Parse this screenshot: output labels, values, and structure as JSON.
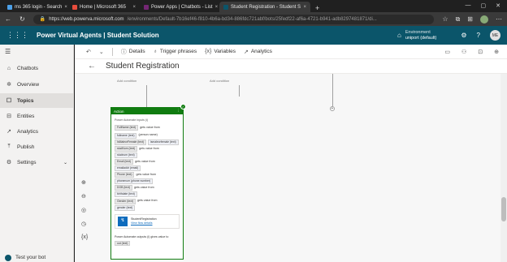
{
  "browser": {
    "tabs": [
      {
        "label": "ms 365 login - Search",
        "color": "#4ca0e8",
        "active": false
      },
      {
        "label": "Home | Microsoft 365",
        "color": "#e74c3c",
        "active": false
      },
      {
        "label": "Power Apps | Chatbots - List",
        "color": "#742774",
        "active": false
      },
      {
        "label": "Student Registration - Student S",
        "color": "#0b556a",
        "active": true
      }
    ],
    "new_tab": "+",
    "url_host": "https://web.powerva.microsoft.com",
    "url_path": "/environments/Default-7b16ef46-f810-4b6a-bd34-886fdc721abf/bots/25fedf22-af6a-4721-b941-adb8297481871/di..."
  },
  "app": {
    "title": "Power Virtual Agents | Student Solution",
    "env_label": "Environment",
    "env_name": "uniport (default)",
    "user_initials": "ME"
  },
  "sidebar": {
    "items": [
      {
        "label": "Chatbots",
        "icon": "home-icon"
      },
      {
        "label": "Overview",
        "icon": "gear-icon"
      },
      {
        "label": "Topics",
        "icon": "topics-icon"
      },
      {
        "label": "Entities",
        "icon": "entities-icon"
      },
      {
        "label": "Analytics",
        "icon": "analytics-icon"
      },
      {
        "label": "Publish",
        "icon": "publish-icon"
      },
      {
        "label": "Settings",
        "icon": "settings-icon"
      }
    ],
    "test_bot": "Test your bot"
  },
  "commandbar": {
    "details": "Details",
    "trigger": "Trigger phrases",
    "variables": "Variables",
    "analytics": "Analytics"
  },
  "page": {
    "title": "Student Registration",
    "add_condition_1": "Add condition",
    "add_condition_2": "Add condition"
  },
  "action_card": {
    "header": "Action",
    "inputs_heading": "Power Automate inputs (i)",
    "params": [
      {
        "name": "FullName (text)",
        "label": "gets value from",
        "var": "fullname (text)",
        "src": "(person name)"
      },
      {
        "name": "IsMaleorFemale (text)",
        "label": "",
        "var": "ismaleorfemale (text)",
        "src": ""
      },
      {
        "name": "studNum (text)",
        "label": "gets value from",
        "var": "studnum (text)",
        "src": ""
      },
      {
        "name": "Email (text)",
        "label": "gets value from",
        "var": "emailaddr (email)",
        "src": ""
      },
      {
        "name": "Phone (text)",
        "label": "gets value from",
        "var": "phonenum (phone number)",
        "src": ""
      },
      {
        "name": "DOB (text)",
        "label": "gets value from",
        "var": "birthdate (text)",
        "src": ""
      },
      {
        "name": "Gender (text)",
        "label": "gets value from",
        "var": "gender (text)",
        "src": ""
      }
    ],
    "flow_name": "StudentRegistration",
    "flow_link": "View flow details",
    "outputs_text": "Power Automate outputs (i) gives value to",
    "output_chip": "out (text)"
  }
}
